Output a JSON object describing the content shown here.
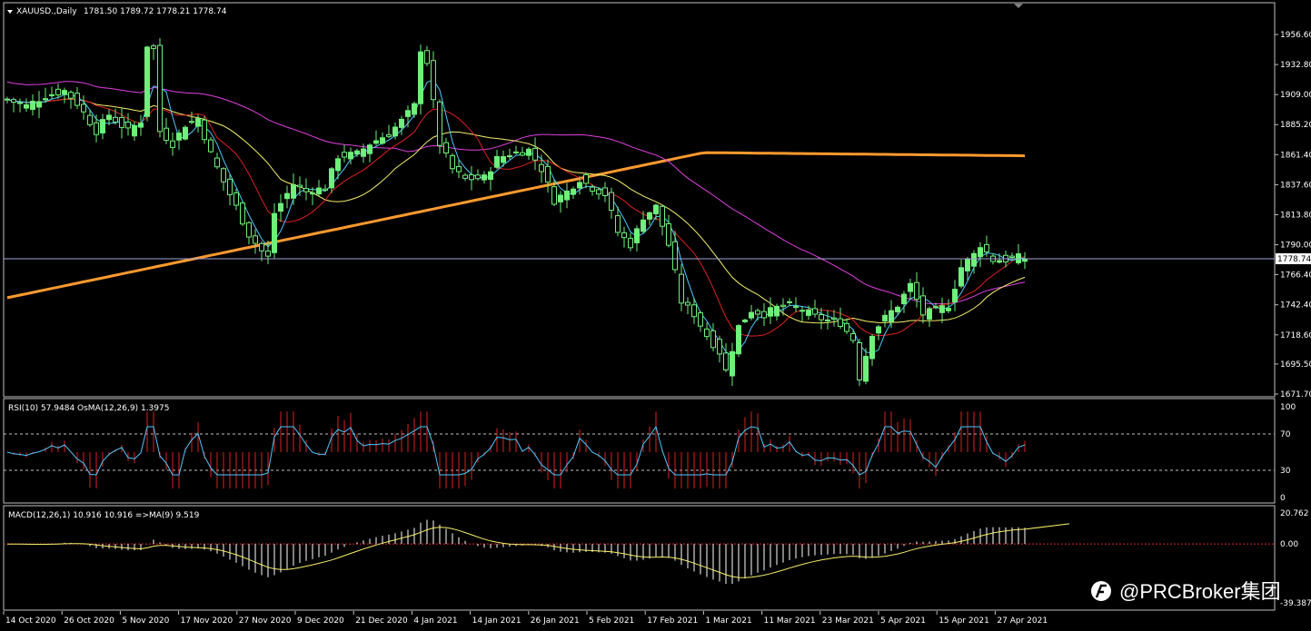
{
  "header": {
    "symbol": "XAUUSD.,Daily",
    "ohlc": "1781.50 1789.72 1778.21 1778.74"
  },
  "current_price_label": "1778.74",
  "rsi_label": "RSI(10) 57.9484  OsMA(12,26,9) 1.3975",
  "macd_label": "MACD(12,26,1) 10.916 10.916  =>MA(9) 9.519",
  "watermark": "@PRCBroker集团",
  "colors": {
    "bull": "#6ef07a",
    "bear": "#000000",
    "ma_fast": "#4ec9ff",
    "ma_red": "#e02020",
    "ma_yellow": "#f5ef6a",
    "ma_magenta": "#e040e0",
    "ma_slow": "#ff9a2e",
    "rsi_line": "#4ec9ff",
    "osma": "#e02020",
    "macd_hist": "#ffffff",
    "macd_signal": "#f5ef6a"
  },
  "chart_data": [
    {
      "type": "candlestick",
      "title": "XAUUSD.,Daily",
      "y_ticks": [
        "1956.60",
        "1932.80",
        "1909.00",
        "1885.20",
        "1861.40",
        "1837.60",
        "1813.80",
        "1790.00",
        "1766.40",
        "1742.40",
        "1718.60",
        "1695.50",
        "1671.70"
      ],
      "ylim": [
        1671.7,
        1956.6
      ],
      "x_ticks": [
        "14 Oct 2020",
        "26 Oct 2020",
        "5 Nov 2020",
        "17 Nov 2020",
        "27 Nov 2020",
        "9 Dec 2020",
        "21 Dec 2020",
        "4 Jan 2021",
        "14 Jan 2021",
        "26 Jan 2021",
        "5 Feb 2021",
        "17 Feb 2021",
        "1 Mar 2021",
        "11 Mar 2021",
        "23 Mar 2021",
        "5 Apr 2021",
        "15 Apr 2021",
        "27 Apr 2021"
      ],
      "close_path": [
        [
          0,
          1905
        ],
        [
          3,
          1900
        ],
        [
          6,
          1908
        ],
        [
          9,
          1912
        ],
        [
          11,
          1902
        ],
        [
          14,
          1880
        ],
        [
          16,
          1893
        ],
        [
          19,
          1880
        ],
        [
          21,
          1888
        ],
        [
          22,
          1948
        ],
        [
          23,
          1945
        ],
        [
          24,
          1880
        ],
        [
          26,
          1870
        ],
        [
          28,
          1885
        ],
        [
          30,
          1890
        ],
        [
          32,
          1862
        ],
        [
          34,
          1840
        ],
        [
          36,
          1820
        ],
        [
          38,
          1798
        ],
        [
          40,
          1785
        ],
        [
          41,
          1780
        ],
        [
          42,
          1815
        ],
        [
          45,
          1838
        ],
        [
          47,
          1832
        ],
        [
          50,
          1835
        ],
        [
          52,
          1860
        ],
        [
          55,
          1862
        ],
        [
          57,
          1870
        ],
        [
          60,
          1878
        ],
        [
          62,
          1888
        ],
        [
          64,
          1900
        ],
        [
          65,
          1945
        ],
        [
          66,
          1935
        ],
        [
          68,
          1870
        ],
        [
          70,
          1850
        ],
        [
          72,
          1842
        ],
        [
          75,
          1843
        ],
        [
          77,
          1858
        ],
        [
          79,
          1862
        ],
        [
          82,
          1865
        ],
        [
          84,
          1850
        ],
        [
          86,
          1825
        ],
        [
          88,
          1832
        ],
        [
          90,
          1842
        ],
        [
          92,
          1835
        ],
        [
          94,
          1830
        ],
        [
          96,
          1800
        ],
        [
          98,
          1790
        ],
        [
          100,
          1812
        ],
        [
          102,
          1820
        ],
        [
          104,
          1790
        ],
        [
          106,
          1745
        ],
        [
          108,
          1735
        ],
        [
          110,
          1718
        ],
        [
          112,
          1705
        ],
        [
          113,
          1690
        ],
        [
          115,
          1725
        ],
        [
          117,
          1738
        ],
        [
          119,
          1735
        ],
        [
          121,
          1740
        ],
        [
          123,
          1742
        ],
        [
          125,
          1738
        ],
        [
          127,
          1733
        ],
        [
          129,
          1730
        ],
        [
          131,
          1728
        ],
        [
          133,
          1715
        ],
        [
          134,
          1685
        ],
        [
          136,
          1720
        ],
        [
          138,
          1732
        ],
        [
          140,
          1742
        ],
        [
          142,
          1758
        ],
        [
          144,
          1735
        ],
        [
          146,
          1738
        ],
        [
          148,
          1742
        ],
        [
          150,
          1772
        ],
        [
          152,
          1782
        ],
        [
          153,
          1790
        ],
        [
          155,
          1778
        ],
        [
          157,
          1778
        ],
        [
          159,
          1780
        ],
        [
          160,
          1779
        ]
      ],
      "overlays": [
        "MA fast (blue)",
        "MA red",
        "MA yellow",
        "MA magenta",
        "MA 200 (orange)"
      ]
    },
    {
      "type": "line",
      "title": "RSI(10) 57.9484  OsMA(12,26,9) 1.3975",
      "y_ticks": [
        "100",
        "70",
        "30",
        "0"
      ],
      "ylim": [
        0,
        100
      ],
      "levels": [
        70,
        30
      ],
      "last_value": 57.9484
    },
    {
      "type": "line",
      "title": "MACD(12,26,1) 10.916 10.916  =>MA(9) 9.519",
      "y_ticks": [
        "20.762",
        "0.00",
        "-39.387"
      ],
      "ylim": [
        -39.387,
        20.762
      ],
      "last_values": {
        "macd": 10.916,
        "signal": 9.519
      }
    }
  ]
}
